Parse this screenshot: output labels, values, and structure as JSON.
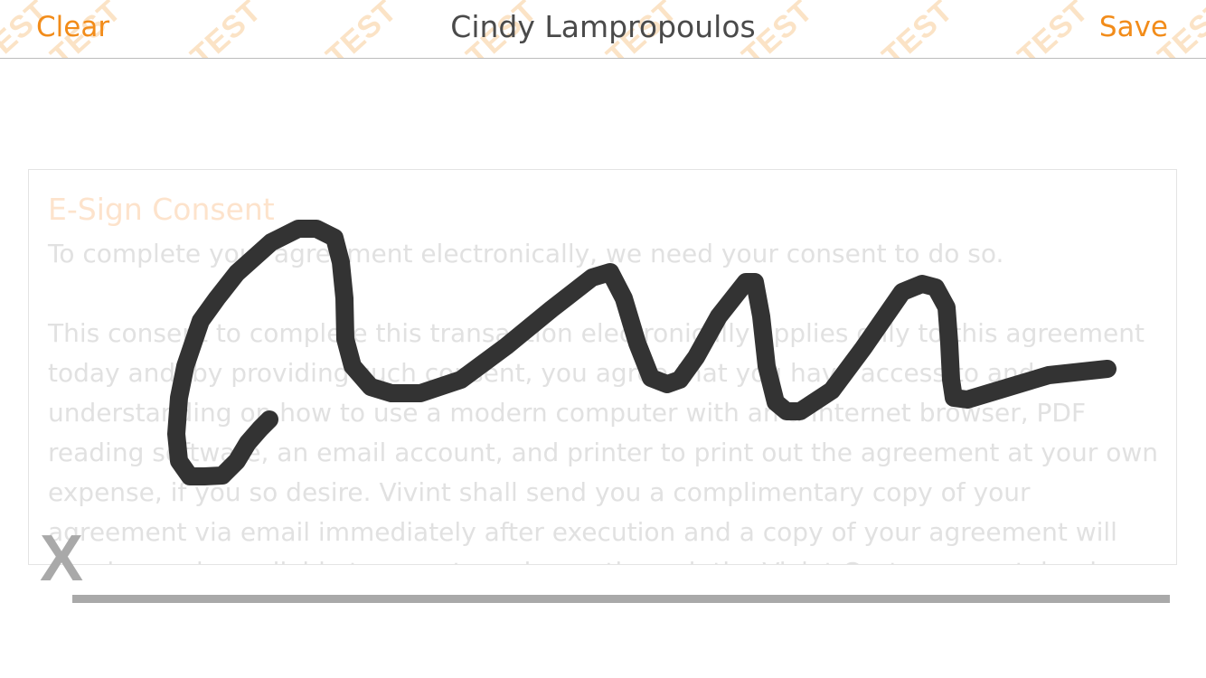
{
  "header": {
    "clear_label": "Clear",
    "title": "Cindy Lampropoulos",
    "save_label": "Save",
    "watermark_text": "TEST"
  },
  "document": {
    "heading": "E-Sign Consent",
    "intro": "To complete your agreement electronically, we need your consent to do so.",
    "body": "This consent to complete this transaction electronically applies only to this agreement today and, by providing such consent, you agree that you have access to and understanding on how to use a modern computer with an a Internet browser, PDF reading software, an email account, and printer to print out the agreement at your own expense, if you so desire. Vivint shall send you a complimentary copy of your agreement via email immediately after execution and a copy of your agreement will also be made available to you at no charge through the Vivint Customer portal or in any electrical format at the time of installation. A hard"
  },
  "signature_pad": {
    "x_mark": "X"
  },
  "colors": {
    "accent": "#f28c1a",
    "title_text": "#4a4a4a",
    "stroke": "#333333",
    "line": "#a9a9a9"
  }
}
